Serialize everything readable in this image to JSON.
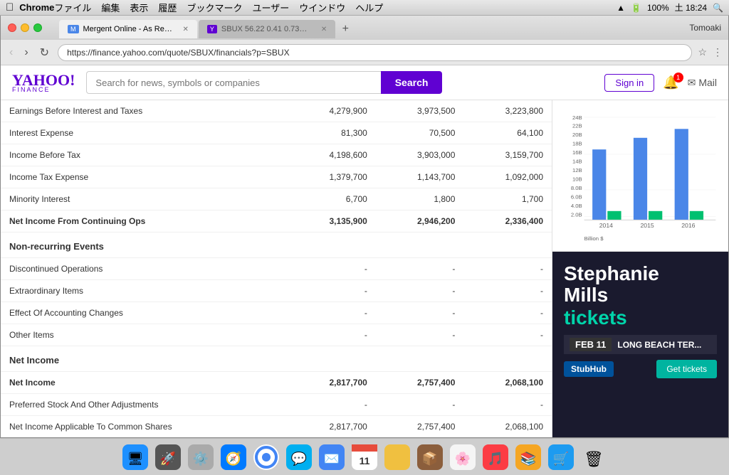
{
  "os": {
    "menubar": {
      "apple": "⌘",
      "app_name": "Chrome",
      "menus": [
        "ファイル",
        "編集",
        "表示",
        "履歴",
        "ブックマーク",
        "ユーザー",
        "ウインドウ",
        "ヘルプ"
      ],
      "battery": "100%",
      "time": "土 18:24",
      "profile": "Tomoaki"
    }
  },
  "browser": {
    "tabs": [
      {
        "label": "Mergent Online - As Reported...",
        "active": true,
        "favicon": "M"
      },
      {
        "label": "SBUX 56.22 0.41 0.73% : Sta...",
        "active": false,
        "favicon": "Y"
      }
    ],
    "url": "https://finance.yahoo.com/quote/SBUX/financials?p=SBUX"
  },
  "yahoo": {
    "logo_text": "YAHOO!",
    "finance_text": "FINANCE",
    "search_placeholder": "Search for news, symbols or companies",
    "search_button": "Search",
    "sign_in": "Sign in",
    "notification_count": "1",
    "mail_label": "Mail"
  },
  "table": {
    "rows": [
      {
        "label": "Earnings Before Interest and Taxes",
        "col1": "4,279,900",
        "col2": "3,973,500",
        "col3": "3,223,800",
        "bold": false
      },
      {
        "label": "Interest Expense",
        "col1": "81,300",
        "col2": "70,500",
        "col3": "64,100",
        "bold": false
      },
      {
        "label": "Income Before Tax",
        "col1": "4,198,600",
        "col2": "3,903,000",
        "col3": "3,159,700",
        "bold": false
      },
      {
        "label": "Income Tax Expense",
        "col1": "1,379,700",
        "col2": "1,143,700",
        "col3": "1,092,000",
        "bold": false
      },
      {
        "label": "Minority Interest",
        "col1": "6,700",
        "col2": "1,800",
        "col3": "1,700",
        "bold": false
      },
      {
        "label": "Net Income From Continuing Ops",
        "col1": "3,135,900",
        "col2": "2,946,200",
        "col3": "2,336,400",
        "bold": true
      }
    ],
    "section_non_recurring": "Non-recurring Events",
    "non_recurring_rows": [
      {
        "label": "Discontinued Operations",
        "col1": "-",
        "col2": "-",
        "col3": "-"
      },
      {
        "label": "Extraordinary Items",
        "col1": "-",
        "col2": "-",
        "col3": "-"
      },
      {
        "label": "Effect Of Accounting Changes",
        "col1": "-",
        "col2": "-",
        "col3": "-"
      },
      {
        "label": "Other Items",
        "col1": "-",
        "col2": "-",
        "col3": "-"
      }
    ],
    "section_net_income": "Net Income",
    "net_income_rows": [
      {
        "label": "Net Income",
        "col1": "2,817,700",
        "col2": "2,757,400",
        "col3": "2,068,100",
        "bold": true
      },
      {
        "label": "Preferred Stock And Other Adjustments",
        "col1": "-",
        "col2": "-",
        "col3": "-",
        "bold": false
      },
      {
        "label": "Net Income Applicable To Common Shares",
        "col1": "2,817,700",
        "col2": "2,757,400",
        "col3": "2,068,100",
        "bold": false
      }
    ]
  },
  "chart": {
    "y_labels": [
      "24B",
      "22B",
      "20B",
      "18B",
      "16B",
      "14B",
      "12B",
      "10B",
      "8.0B",
      "6.0B",
      "4.0B",
      "2.0B"
    ],
    "x_labels": [
      "2014",
      "2015",
      "2016"
    ],
    "x_label_unit": "Billion $",
    "bars": [
      {
        "year": "2014",
        "blue": 16.5,
        "green": 0.8
      },
      {
        "year": "2015",
        "blue": 19.2,
        "green": 1.0
      },
      {
        "year": "2016",
        "blue": 21.3,
        "green": 1.0
      }
    ]
  },
  "ad": {
    "name_line1": "Stephanie",
    "name_line2": "Mills",
    "tickets_text": "tickets",
    "date": "FEB 11",
    "venue": "LONG BEACH TER...",
    "brand": "StubHub",
    "cta": "Get tickets"
  },
  "dock": {
    "icons": [
      "🍎",
      "🚀",
      "⚙️",
      "🌐",
      "🔵",
      "📘",
      "📧",
      "📅",
      "🗒️",
      "📦",
      "🖼️",
      "🎵",
      "📚",
      "🛒",
      "🗑️"
    ]
  }
}
